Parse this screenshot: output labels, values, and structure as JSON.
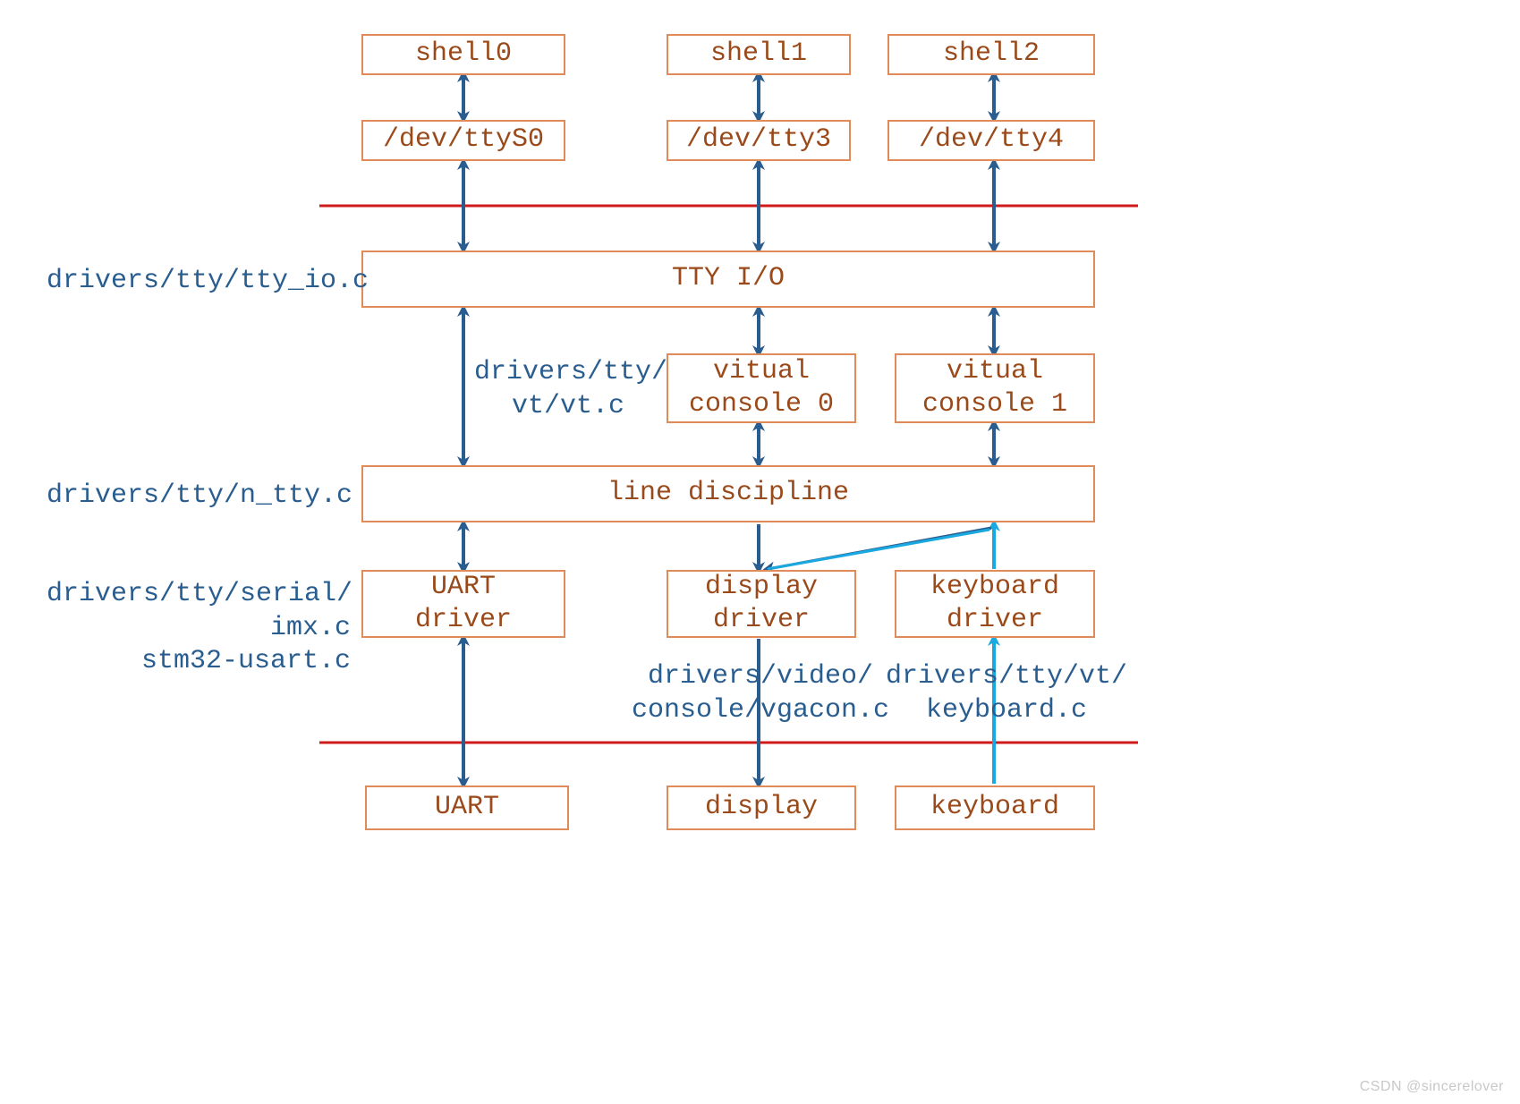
{
  "boxes": {
    "shell0": "shell0",
    "shell1": "shell1",
    "shell2": "shell2",
    "dev_ttyS0": "/dev/ttyS0",
    "dev_tty3": "/dev/tty3",
    "dev_tty4": "/dev/tty4",
    "tty_io": "TTY I/O",
    "vc0_l1": "vitual",
    "vc0_l2": "console 0",
    "vc1_l1": "vitual",
    "vc1_l2": "console 1",
    "line_discipline": "line discipline",
    "uart_driver_l1": "UART",
    "uart_driver_l2": "driver",
    "display_driver_l1": "display",
    "display_driver_l2": "driver",
    "keyboard_driver_l1": "keyboard",
    "keyboard_driver_l2": "driver",
    "uart": "UART",
    "display": "display",
    "keyboard": "keyboard"
  },
  "labels": {
    "tty_io_c": "drivers/tty/tty_io.c",
    "vt_c_l1": "drivers/tty/",
    "vt_c_l2": "vt/vt.c",
    "n_tty_c": "drivers/tty/n_tty.c",
    "serial_l1": "drivers/tty/serial/",
    "serial_l2": "imx.c",
    "serial_l3": "stm32-usart.c",
    "vgacon_l1": "drivers/video/",
    "vgacon_l2": "console/vgacon.c",
    "keyboard_c_l1": "drivers/tty/vt/",
    "keyboard_c_l2": "keyboard.c"
  },
  "watermark": "CSDN @sincerelover"
}
